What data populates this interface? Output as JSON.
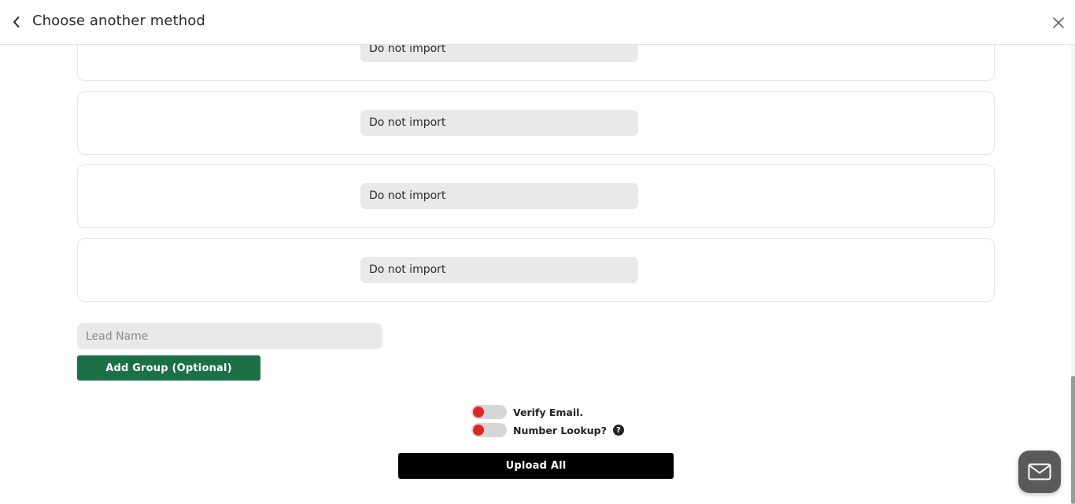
{
  "header": {
    "title": "Choose another method",
    "back_icon": "chevron-left-icon",
    "close_icon": "close-icon"
  },
  "mapping_rows": [
    {
      "value": "Do not import"
    },
    {
      "value": "Do not import"
    },
    {
      "value": "Do not import"
    },
    {
      "value": "Do not import"
    }
  ],
  "lead_name": {
    "placeholder": "Lead Name",
    "value": ""
  },
  "add_group_label": "Add Group (Optional)",
  "toggles": {
    "verify_email": {
      "label": "Verify Email.",
      "enabled": false
    },
    "number_lookup": {
      "label": "Number Lookup?",
      "enabled": false,
      "help_icon": "question-circle-icon"
    }
  },
  "upload_label": "Upload All",
  "colors": {
    "primary_green": "#1b7046",
    "toggle_off_knob": "#e02424",
    "upload_button": "#000000",
    "mail_fab": "#5a5a5a"
  },
  "fab": {
    "icon": "mail-icon"
  }
}
